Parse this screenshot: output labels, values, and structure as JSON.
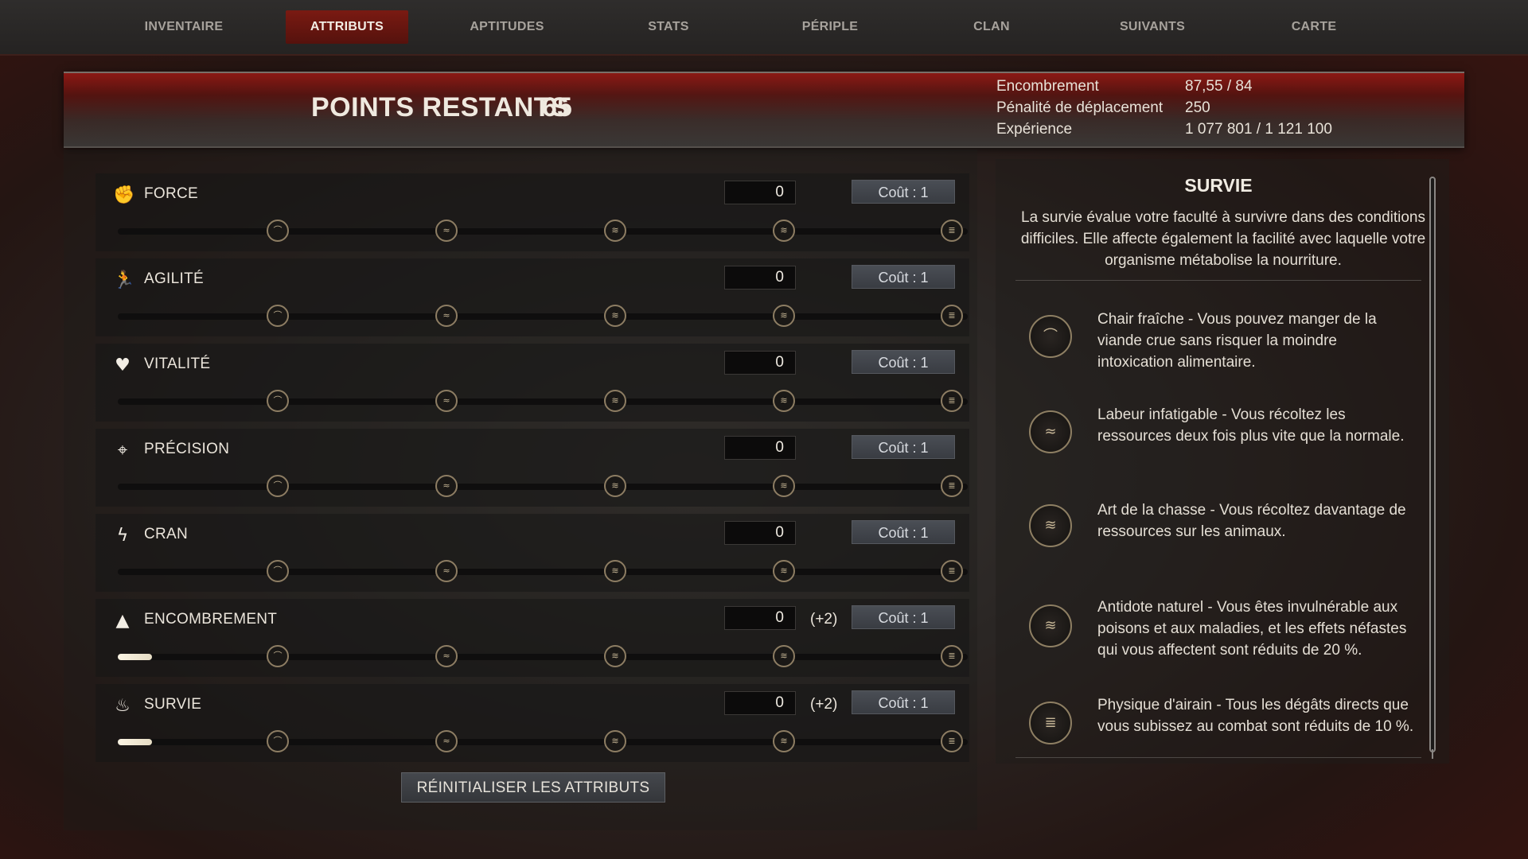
{
  "tabs": [
    {
      "label": "INVENTAIRE",
      "active": false
    },
    {
      "label": "ATTRIBUTS",
      "active": true
    },
    {
      "label": "APTITUDES",
      "active": false
    },
    {
      "label": "STATS",
      "active": false
    },
    {
      "label": "PÉRIPLE",
      "active": false
    },
    {
      "label": "CLAN",
      "active": false
    },
    {
      "label": "SUIVANTS",
      "active": false
    },
    {
      "label": "CARTE",
      "active": false
    }
  ],
  "header": {
    "points_label": "POINTS RESTANTS",
    "points_value": "65",
    "stats": [
      {
        "label": "Encombrement",
        "value": "87,55 / 84"
      },
      {
        "label": "Pénalité de déplacement",
        "value": "250"
      },
      {
        "label": "Expérience",
        "value": "1 077 801 / 1 121 100"
      }
    ]
  },
  "attributes": [
    {
      "name": "FORCE",
      "icon": "fist-icon",
      "value": "0",
      "bonus": "",
      "cost": "Coût : 1",
      "progress": 0
    },
    {
      "name": "AGILITÉ",
      "icon": "running-figure-icon",
      "value": "0",
      "bonus": "",
      "cost": "Coût : 1",
      "progress": 0
    },
    {
      "name": "VITALITÉ",
      "icon": "heart-icon",
      "value": "0",
      "bonus": "",
      "cost": "Coût : 1",
      "progress": 0
    },
    {
      "name": "PRÉCISION",
      "icon": "crosshair-icon",
      "value": "0",
      "bonus": "",
      "cost": "Coût : 1",
      "progress": 0
    },
    {
      "name": "CRAN",
      "icon": "lightning-icon",
      "value": "0",
      "bonus": "",
      "cost": "Coût : 1",
      "progress": 0
    },
    {
      "name": "ENCOMBREMENT",
      "icon": "weight-icon",
      "value": "0",
      "bonus": "(+2)",
      "cost": "Coût : 1",
      "progress": 0.04
    },
    {
      "name": "SURVIE",
      "icon": "campfire-icon",
      "value": "0",
      "bonus": "(+2)",
      "cost": "Coût : 1",
      "progress": 0.04
    }
  ],
  "reset_label": "RÉINITIALISER LES ATTRIBUTS",
  "detail": {
    "title": "SURVIE",
    "description": "La survie évalue votre faculté à survivre dans des conditions difficiles. Elle affecte également la facilité avec laquelle votre organisme métabolise la nourriture.",
    "perks": [
      {
        "text": "Chair fraîche - Vous pouvez manger de la viande crue sans risquer la moindre intoxication alimentaire.",
        "icon": "perk-tier-1-icon"
      },
      {
        "text": "Labeur infatigable - Vous récoltez les ressources deux fois plus vite que la normale.",
        "icon": "perk-tier-2-icon"
      },
      {
        "text": "Art de la chasse - Vous récoltez davantage de ressources sur les animaux.",
        "icon": "perk-tier-3-icon"
      },
      {
        "text": "Antidote naturel - Vous êtes invulnérable aux poisons et aux maladies, et les effets néfastes qui vous affectent sont réduits de 20 %.",
        "icon": "perk-tier-4-icon"
      },
      {
        "text": "Physique d'airain - Tous les dégâts directs que vous subissez au combat sont réduits de 10 %.",
        "icon": "perk-tier-5-icon"
      }
    ]
  },
  "colors": {
    "accent": "#7a1a12",
    "node_border": "#8d7d63",
    "fill": "#fbf4e3"
  }
}
